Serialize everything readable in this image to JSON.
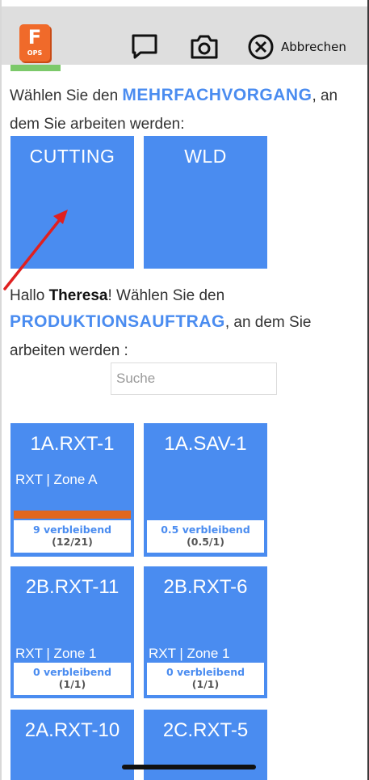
{
  "app": {
    "logo_letter": "F",
    "logo_sub": "OPS"
  },
  "toolbar": {
    "comment_icon": "comment-icon",
    "camera_icon": "camera-icon",
    "cancel_icon": "close-circle-icon",
    "cancel_label": "Abbrechen"
  },
  "operation_prompt": {
    "prefix": "Wählen Sie den ",
    "highlight": "MEHRFACHVORGANG",
    "suffix_line1": ", an",
    "line2": "dem Sie arbeiten werden:"
  },
  "operations": [
    {
      "label": "CUTTING"
    },
    {
      "label": "WLD"
    }
  ],
  "order_prompt": {
    "greeting": "Hallo ",
    "user": "Theresa",
    "after_user": "! Wählen Sie den",
    "highlight": "PRODUKTIONSAUFTRAG",
    "after_highlight": ", an dem Sie",
    "line3": "arbeiten werden :"
  },
  "search": {
    "placeholder": "Suche"
  },
  "orders": [
    {
      "title": "1A.RXT-1",
      "zone": "RXT | Zone A",
      "remaining": "9 verbleibend",
      "count": "(12/21)",
      "progress": 0.57
    },
    {
      "title": "1A.SAV-1",
      "zone": "",
      "remaining": "0.5 verbleibend",
      "count": "(0.5/1)",
      "progress": 0.5
    },
    {
      "title": "2B.RXT-11",
      "zone": "RXT | Zone 1",
      "remaining": "0 verbleibend",
      "count": "(1/1)",
      "progress": 1
    },
    {
      "title": "2B.RXT-6",
      "zone": "RXT | Zone 1",
      "remaining": "0 verbleibend",
      "count": "(1/1)",
      "progress": 1
    },
    {
      "title": "2A.RXT-10"
    },
    {
      "title": "2C.RXT-5"
    }
  ],
  "colors": {
    "accent": "#4a8cf0",
    "progress": "#e2671f",
    "arrow": "#e02020"
  }
}
